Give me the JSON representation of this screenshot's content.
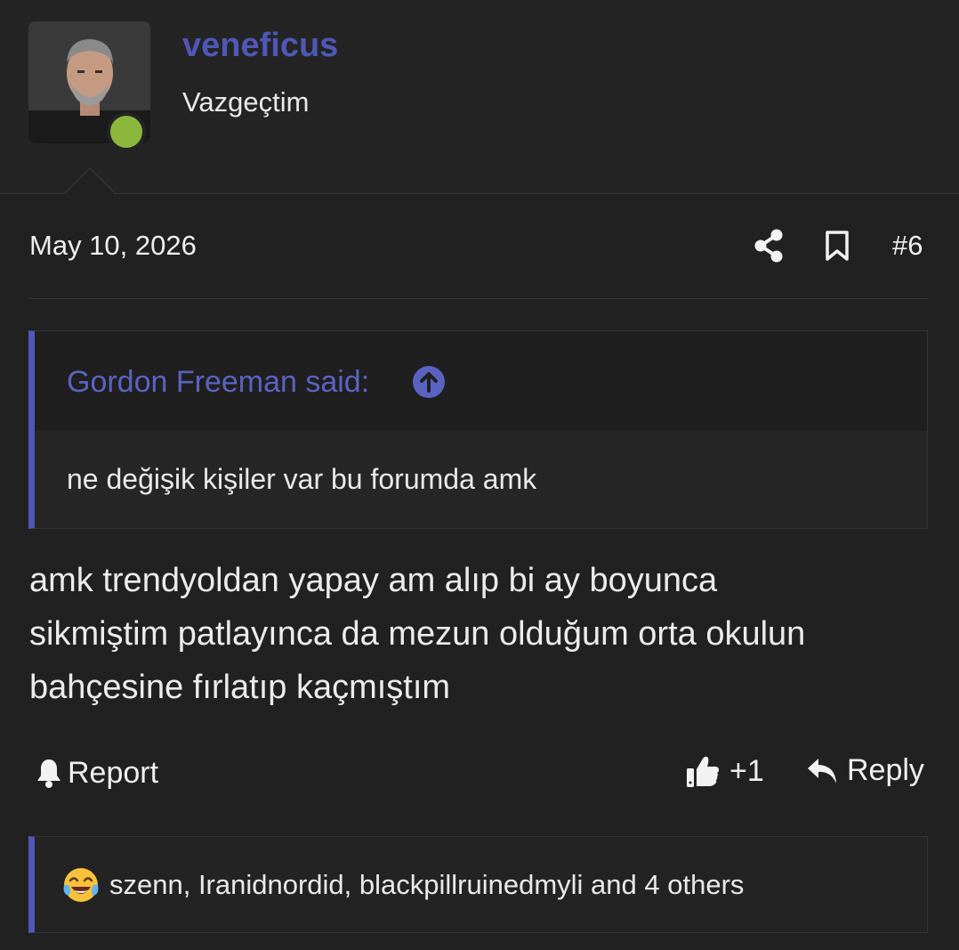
{
  "user": {
    "username": "veneficus",
    "title": "Vazgeçtim",
    "status": "online",
    "status_color": "#8bb83c"
  },
  "post": {
    "date": "May 10, 2026",
    "number": "#6",
    "text_lines": [
      "amk trendyoldan yapay am alıp bi ay boyunca",
      "sikmiştim patlayınca da mezun olduğum orta okulun",
      "bahçesine fırlatıp kaçmıştım"
    ]
  },
  "quote": {
    "author_line": "Gordon Freeman said:",
    "body": "ne değişik kişiler var bu forumda amk"
  },
  "actions": {
    "report_label": "Report",
    "like_count": "+1",
    "reply_label": "Reply"
  },
  "reactions": {
    "emoji": "joy-tears-icon",
    "text": "szenn, Iranidnordid, blackpillruinedmyli and 4 others"
  },
  "colors": {
    "accent": "#4f57b7",
    "background": "#212121"
  }
}
